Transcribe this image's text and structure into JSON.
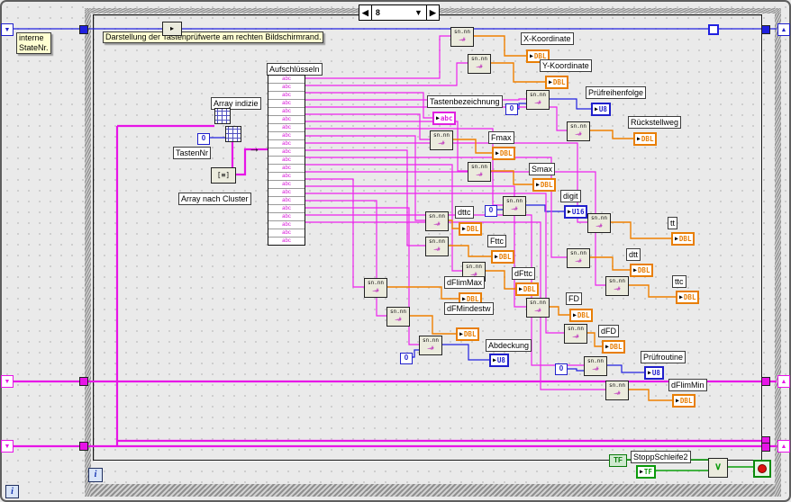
{
  "case_structure": {
    "selector_value": "8"
  },
  "icons": {
    "prev": "◀",
    "next": "▶",
    "dropdown": "▼",
    "term_arrow": "▶",
    "sr_down": "▼",
    "sr_up": "▲",
    "top_node": "▸",
    "or": "∨",
    "a2c_glyph": "[≡]",
    "input_arrow": "→"
  },
  "comments": {
    "main_comment": "Darstellung der Tastenprüfwerte am rechten Bildschirmrand.",
    "state_note": "interne\nStateNr."
  },
  "left_section": {
    "array_index_label": "Array indizie",
    "tastennr_label": "TastenNr",
    "array_to_cluster_label": "Array nach Cluster",
    "unbundle_label": "Aufschlüsseln"
  },
  "constants": {
    "zero": "0",
    "true_false": "TF"
  },
  "conv_icon": {
    "line1": "sn.nn",
    "line2": "→#"
  },
  "unbundle_rows": [
    "abc",
    "abc",
    "abc",
    "abc",
    "abc",
    "abc",
    "abc",
    "abc",
    "abc",
    "abc",
    "abc",
    "abc",
    "abc",
    "abc",
    "abc",
    "abc",
    "abc",
    "abc",
    "abc",
    "abc",
    "abc"
  ],
  "indicators": [
    {
      "label": "X-Koordinate",
      "type": "DBL"
    },
    {
      "label": "Y-Koordinate",
      "type": "DBL"
    },
    {
      "label": "Prüfreihenfolge",
      "type": "U8"
    },
    {
      "label": "Tastenbezeichnung",
      "type": "abc"
    },
    {
      "label": "Rückstellweg",
      "type": "DBL"
    },
    {
      "label": "Fmax",
      "type": "DBL"
    },
    {
      "label": "Smax",
      "type": "DBL"
    },
    {
      "label": "digit",
      "type": "U16"
    },
    {
      "label": "dttc",
      "type": "DBL"
    },
    {
      "label": "tt",
      "type": "DBL"
    },
    {
      "label": "Fttc",
      "type": "DBL"
    },
    {
      "label": "dtt",
      "type": "DBL"
    },
    {
      "label": "dFttc",
      "type": "DBL"
    },
    {
      "label": "ttc",
      "type": "DBL"
    },
    {
      "label": "dFlimMax",
      "type": "DBL"
    },
    {
      "label": "FD",
      "type": "DBL"
    },
    {
      "label": "dFD",
      "type": "DBL"
    },
    {
      "label": "dFMindestw",
      "type": "DBL"
    },
    {
      "label": "Abdeckung",
      "type": "U8"
    },
    {
      "label": "Prüfroutine",
      "type": "U8"
    },
    {
      "label": "dFlimMin",
      "type": "DBL"
    }
  ],
  "loop": {
    "iteration": "i",
    "stop_label": "StoppSchleife2",
    "stop_terminal_type": "TF"
  }
}
